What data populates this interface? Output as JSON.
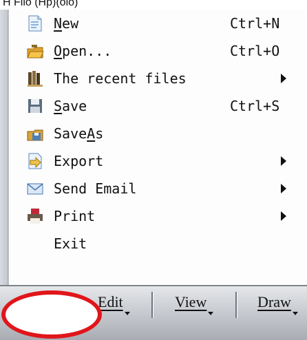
{
  "title_fragment": "Ĥ Filo (Hp)(oio)",
  "menu": {
    "items": [
      {
        "name": "new",
        "icon": "new-document-icon",
        "pre": "",
        "ul": "N",
        "post": "ew",
        "shortcut": "Ctrl+N",
        "submenu": false
      },
      {
        "name": "open",
        "icon": "open-folder-icon",
        "pre": "",
        "ul": "O",
        "post": "pen...",
        "shortcut": "Ctrl+O",
        "submenu": false
      },
      {
        "name": "recent-files",
        "icon": "books-icon",
        "pre": "The recent files",
        "ul": "",
        "post": "",
        "shortcut": "",
        "submenu": true
      },
      {
        "name": "save",
        "icon": "floppy-save-icon",
        "pre": "",
        "ul": "S",
        "post": "ave",
        "shortcut": "Ctrl+S",
        "submenu": false
      },
      {
        "name": "save-as",
        "icon": "save-as-icon",
        "pre": "Save",
        "ul": "A",
        "post": "s",
        "shortcut": "",
        "submenu": false
      },
      {
        "name": "export",
        "icon": "export-icon",
        "pre": "Export",
        "ul": "",
        "post": "",
        "shortcut": "",
        "submenu": true
      },
      {
        "name": "send-email",
        "icon": "envelope-icon",
        "pre": "Send Email",
        "ul": "",
        "post": "",
        "shortcut": "",
        "submenu": true
      },
      {
        "name": "print",
        "icon": "printer-icon",
        "pre": "Print",
        "ul": "",
        "post": "",
        "shortcut": "",
        "submenu": true
      },
      {
        "name": "exit",
        "icon": "",
        "pre": "Exit",
        "ul": "",
        "post": "",
        "shortcut": "",
        "submenu": false
      }
    ]
  },
  "menubar": {
    "tabs": [
      {
        "name": "edit",
        "label": "Edit"
      },
      {
        "name": "view",
        "label": "View"
      },
      {
        "name": "draw",
        "label": "Draw"
      }
    ]
  },
  "colors": {
    "highlight_ellipse": "#e0161b"
  }
}
